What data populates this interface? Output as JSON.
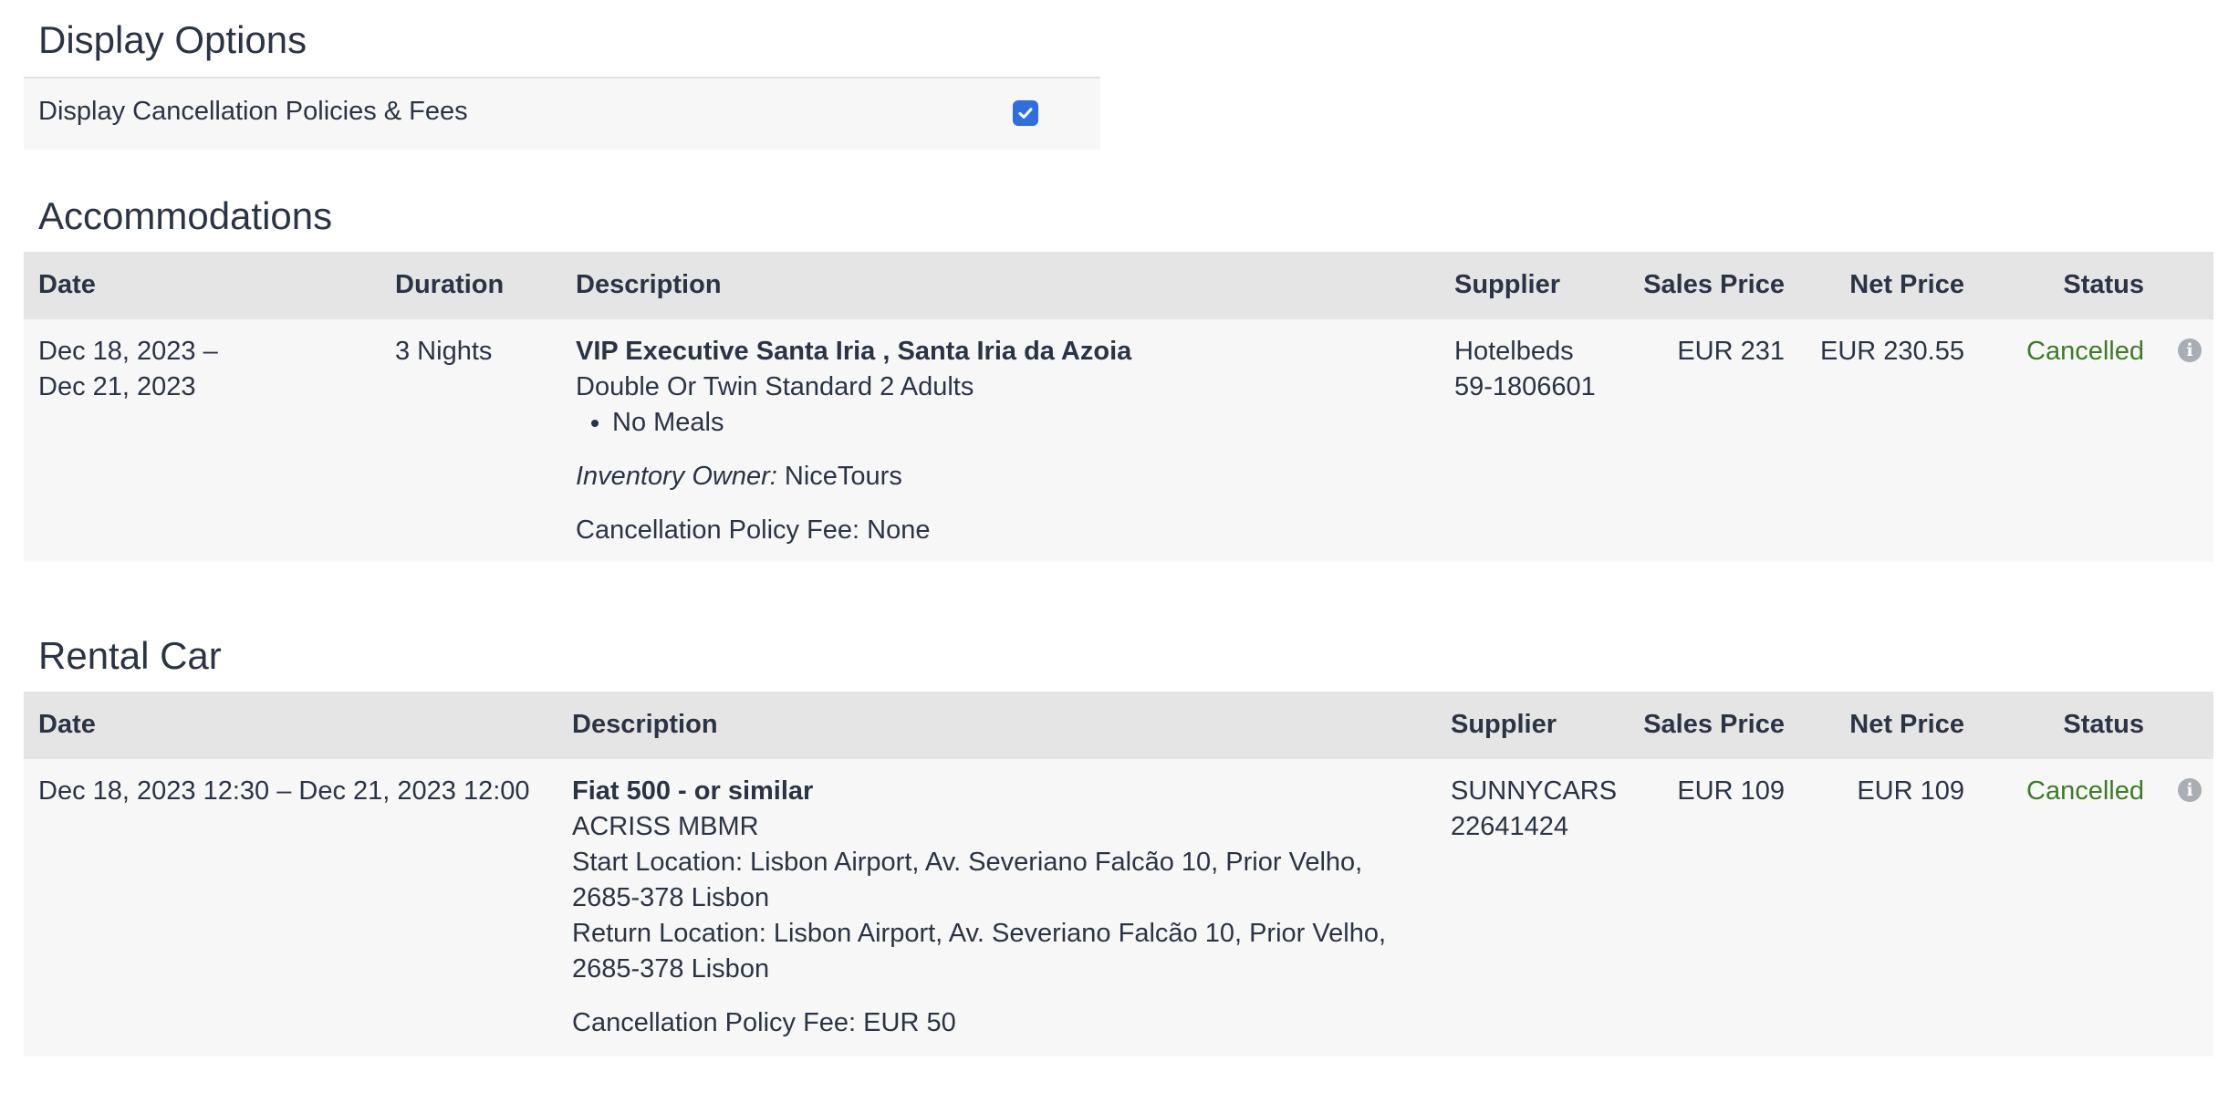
{
  "display_options": {
    "title": "Display Options",
    "cancellation_label": "Display Cancellation Policies & Fees",
    "cancellation_checked": true
  },
  "accommodations": {
    "title": "Accommodations",
    "headers": {
      "date": "Date",
      "duration": "Duration",
      "description": "Description",
      "supplier": "Supplier",
      "sales_price": "Sales Price",
      "net_price": "Net Price",
      "status": "Status"
    },
    "row": {
      "date_start": "Dec 18, 2023 –",
      "date_end": "Dec 21, 2023",
      "duration": "3 Nights",
      "hotel_name": "VIP Executive Santa Iria , Santa Iria da Azoia",
      "room_type": "Double Or Twin Standard 2 Adults",
      "meals": "No Meals",
      "inventory_owner_label": "Inventory Owner:",
      "inventory_owner": "NiceTours",
      "cancellation_fee": "Cancellation Policy Fee: None",
      "supplier_name": "Hotelbeds",
      "supplier_ref": "59-1806601",
      "sales_price": "EUR 231",
      "net_price": "EUR 230.55",
      "status": "Cancelled"
    }
  },
  "rental_car": {
    "title": "Rental Car",
    "headers": {
      "date": "Date",
      "description": "Description",
      "supplier": "Supplier",
      "sales_price": "Sales Price",
      "net_price": "Net Price",
      "status": "Status"
    },
    "row": {
      "date": "Dec 18, 2023 12:30 – Dec 21, 2023 12:00",
      "car_name": "Fiat 500 - or similar",
      "acriss": "ACRISS MBMR",
      "start_location_1": "Start Location: Lisbon Airport, Av. Severiano Falcão 10, Prior Velho,",
      "start_location_2": "2685-378 Lisbon",
      "return_location_1": "Return Location: Lisbon Airport, Av. Severiano Falcão 10, Prior Velho,",
      "return_location_2": "2685-378 Lisbon",
      "cancellation_fee": "Cancellation Policy Fee: EUR 50",
      "supplier_name": "SUNNYCARS",
      "supplier_ref": "22641424",
      "sales_price": "EUR 109",
      "net_price": "EUR 109",
      "status": "Cancelled"
    }
  },
  "colors": {
    "status_cancelled": "#3b7d23",
    "checkbox": "#2e6fde",
    "header_bg": "#e5e5e5",
    "row_bg": "#f7f7f7"
  },
  "icons": {
    "info": "info-circle-icon",
    "check": "checkmark-icon"
  }
}
